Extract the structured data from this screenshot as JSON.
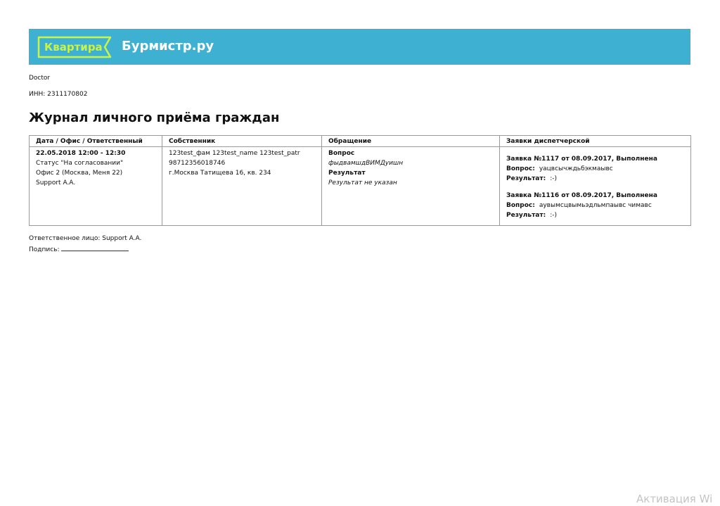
{
  "header": {
    "logo_badge_text": "Квартира",
    "logo_word_text": "Бурмистр.ру",
    "banner_color": "#3eb1d3",
    "badge_color": "#c8f34a"
  },
  "org": {
    "name": "Doctor",
    "inn": "ИНН: 2311170802"
  },
  "title": "Журнал личного приёма граждан",
  "table": {
    "columns": [
      "Дата / Офис / Ответственный",
      "Собственник",
      "Обращение",
      "Заявки диспетчерской"
    ],
    "row": {
      "datetime": "22.05.2018 12:00 - 12:30",
      "status": "Статус \"На согласовании\"",
      "office": "Офис 2 (Москва, Меня 22)",
      "responsible": "Support A.A.",
      "owner_name": "123test_фам 123test_name 123test_patr",
      "owner_phone": "98712356018746",
      "owner_address": "г.Москва Татищева 16, кв. 234",
      "question_label": "Вопрос",
      "question_text": "фыдвамшдВИМДуишн",
      "result_label": "Результат",
      "result_text": "Результат не указан",
      "requests": [
        {
          "title": "Заявка №1117 от 08.09.2017, Выполнена",
          "question_label": "Вопрос:",
          "question_text": "уацвсычждьбэкмаывс",
          "result_label": "Результат:",
          "result_text": ":-)"
        },
        {
          "title": "Заявка №1116 от 08.09.2017, Выполнена",
          "question_label": "Вопрос:",
          "question_text": "аувымсцвымьэдльмпаывс чимавс",
          "result_label": "Результат:",
          "result_text": ":-)"
        }
      ]
    }
  },
  "footer": {
    "responsible": "Ответственное лицо: Support A.A.",
    "signature_label": "Подпись:"
  },
  "watermark": "Активация Wi"
}
